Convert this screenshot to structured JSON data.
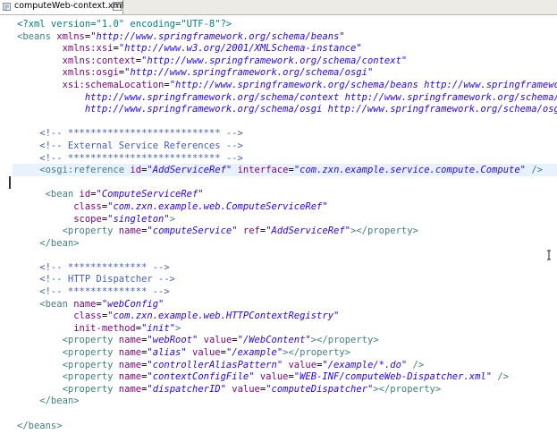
{
  "tab": {
    "title": "computeWeb-context.xml",
    "close_glyph": "×",
    "icon": "xml-file-icon"
  },
  "code_lines": [
    [
      {
        "k": "p",
        "s": "<?xml version=\"1.0\" encoding=\"UTF-8\"?>"
      }
    ],
    [
      {
        "k": "t",
        "s": "<beans "
      },
      {
        "k": "a",
        "s": "xmlns"
      },
      {
        "k": "x",
        "s": "="
      },
      {
        "k": "v",
        "s": "\"http://www.springframework.org/schema/beans\""
      }
    ],
    [
      {
        "k": "x",
        "s": "        "
      },
      {
        "k": "a",
        "s": "xmlns:xsi"
      },
      {
        "k": "x",
        "s": "="
      },
      {
        "k": "v",
        "s": "\"http://www.w3.org/2001/XMLSchema-instance\""
      }
    ],
    [
      {
        "k": "x",
        "s": "        "
      },
      {
        "k": "a",
        "s": "xmlns:context"
      },
      {
        "k": "x",
        "s": "="
      },
      {
        "k": "v",
        "s": "\"http://www.springframework.org/schema/context\""
      }
    ],
    [
      {
        "k": "x",
        "s": "        "
      },
      {
        "k": "a",
        "s": "xmlns:osgi"
      },
      {
        "k": "x",
        "s": "="
      },
      {
        "k": "v",
        "s": "\"http://www.springframework.org/schema/osgi\""
      }
    ],
    [
      {
        "k": "x",
        "s": "        "
      },
      {
        "k": "a",
        "s": "xsi:schemaLocation"
      },
      {
        "k": "x",
        "s": "="
      },
      {
        "k": "v",
        "s": "\"http://www.springframework.org/schema/beans http://www.springframework.org/schema/beans/spring-beans.xsd"
      }
    ],
    [
      {
        "k": "v",
        "s": "            http://www.springframework.org/schema/context http://www.springframework.org/schema/context/spring-context.xsd"
      }
    ],
    [
      {
        "k": "v",
        "s": "            http://www.springframework.org/schema/osgi http://www.springframework.org/schema/osgi/spring-osgi.xsd\">"
      }
    ],
    [],
    [
      {
        "k": "c",
        "s": "    <!-- *************************** -->"
      }
    ],
    [
      {
        "k": "c",
        "s": "    <!-- External Service References -->"
      }
    ],
    [
      {
        "k": "c",
        "s": "    <!-- *************************** -->"
      }
    ],
    [
      {
        "k": "t",
        "s": "    <osgi:reference "
      },
      {
        "k": "a",
        "s": "id"
      },
      {
        "k": "x",
        "s": "="
      },
      {
        "k": "v",
        "s": "\"AddServiceRef\""
      },
      {
        "k": "x",
        "s": " "
      },
      {
        "k": "a",
        "s": "interface"
      },
      {
        "k": "x",
        "s": "="
      },
      {
        "k": "v",
        "s": "\"com.zxn.example.service.compute.Compute\""
      },
      {
        "k": "t",
        "s": " />"
      }
    ],
    [],
    [
      {
        "k": "t",
        "s": "     <bean "
      },
      {
        "k": "a",
        "s": "id"
      },
      {
        "k": "x",
        "s": "="
      },
      {
        "k": "v",
        "s": "\"ComputeServiceRef\""
      }
    ],
    [
      {
        "k": "x",
        "s": "          "
      },
      {
        "k": "a",
        "s": "class"
      },
      {
        "k": "x",
        "s": "="
      },
      {
        "k": "v",
        "s": "\"com.zxn.example.web.ComputeServiceRef\""
      }
    ],
    [
      {
        "k": "x",
        "s": "          "
      },
      {
        "k": "a",
        "s": "scope"
      },
      {
        "k": "x",
        "s": "="
      },
      {
        "k": "v",
        "s": "\"singleton\""
      },
      {
        "k": "t",
        "s": ">"
      }
    ],
    [
      {
        "k": "t",
        "s": "        <property "
      },
      {
        "k": "a",
        "s": "name"
      },
      {
        "k": "x",
        "s": "="
      },
      {
        "k": "v",
        "s": "\"computeService\""
      },
      {
        "k": "x",
        "s": " "
      },
      {
        "k": "a",
        "s": "ref"
      },
      {
        "k": "x",
        "s": "="
      },
      {
        "k": "v",
        "s": "\"AddServiceRef\""
      },
      {
        "k": "t",
        "s": "></property>"
      }
    ],
    [
      {
        "k": "t",
        "s": "    </bean>"
      }
    ],
    [],
    [
      {
        "k": "c",
        "s": "    <!-- ************** -->"
      }
    ],
    [
      {
        "k": "c",
        "s": "    <!-- HTTP Dispatcher -->"
      }
    ],
    [
      {
        "k": "c",
        "s": "    <!-- ************** -->"
      }
    ],
    [
      {
        "k": "t",
        "s": "    <bean "
      },
      {
        "k": "a",
        "s": "name"
      },
      {
        "k": "x",
        "s": "="
      },
      {
        "k": "v",
        "s": "\"webConfig\""
      }
    ],
    [
      {
        "k": "x",
        "s": "          "
      },
      {
        "k": "a",
        "s": "class"
      },
      {
        "k": "x",
        "s": "="
      },
      {
        "k": "v",
        "s": "\"com.zxn.example.web.HTTPContextRegistry\""
      }
    ],
    [
      {
        "k": "x",
        "s": "          "
      },
      {
        "k": "a",
        "s": "init-method"
      },
      {
        "k": "x",
        "s": "="
      },
      {
        "k": "v",
        "s": "\"init\""
      },
      {
        "k": "t",
        "s": ">"
      }
    ],
    [
      {
        "k": "t",
        "s": "        <property "
      },
      {
        "k": "a",
        "s": "name"
      },
      {
        "k": "x",
        "s": "="
      },
      {
        "k": "v",
        "s": "\"webRoot\""
      },
      {
        "k": "x",
        "s": " "
      },
      {
        "k": "a",
        "s": "value"
      },
      {
        "k": "x",
        "s": "="
      },
      {
        "k": "v",
        "s": "\"/WebContent\""
      },
      {
        "k": "t",
        "s": "></property>"
      }
    ],
    [
      {
        "k": "t",
        "s": "        <property "
      },
      {
        "k": "a",
        "s": "name"
      },
      {
        "k": "x",
        "s": "="
      },
      {
        "k": "v",
        "s": "\"alias\""
      },
      {
        "k": "x",
        "s": " "
      },
      {
        "k": "a",
        "s": "value"
      },
      {
        "k": "x",
        "s": "="
      },
      {
        "k": "v",
        "s": "\"/example\""
      },
      {
        "k": "t",
        "s": "></property>"
      }
    ],
    [
      {
        "k": "t",
        "s": "        <property "
      },
      {
        "k": "a",
        "s": "name"
      },
      {
        "k": "x",
        "s": "="
      },
      {
        "k": "v",
        "s": "\"controllerAliasPattern\""
      },
      {
        "k": "x",
        "s": " "
      },
      {
        "k": "a",
        "s": "value"
      },
      {
        "k": "x",
        "s": "="
      },
      {
        "k": "v",
        "s": "\"/example/*.do\""
      },
      {
        "k": "t",
        "s": " />"
      }
    ],
    [
      {
        "k": "t",
        "s": "        <property "
      },
      {
        "k": "a",
        "s": "name"
      },
      {
        "k": "x",
        "s": "="
      },
      {
        "k": "v",
        "s": "\"contextConfigFile\""
      },
      {
        "k": "x",
        "s": " "
      },
      {
        "k": "a",
        "s": "value"
      },
      {
        "k": "x",
        "s": "="
      },
      {
        "k": "v",
        "s": "\"WEB-INF/computeWeb-Dispatcher.xml\""
      },
      {
        "k": "t",
        "s": " />"
      }
    ],
    [
      {
        "k": "t",
        "s": "        <property "
      },
      {
        "k": "a",
        "s": "name"
      },
      {
        "k": "x",
        "s": "="
      },
      {
        "k": "v",
        "s": "\"dispatcherID\""
      },
      {
        "k": "x",
        "s": " "
      },
      {
        "k": "a",
        "s": "value"
      },
      {
        "k": "x",
        "s": "="
      },
      {
        "k": "v",
        "s": "\"computeDispatcher\""
      },
      {
        "k": "t",
        "s": "></property>"
      }
    ],
    [
      {
        "k": "t",
        "s": "    </bean>"
      }
    ],
    [],
    [
      {
        "k": "t",
        "s": "</beans>"
      }
    ]
  ],
  "highlighted_line": 12,
  "colors": {
    "processing_instruction": "#008080",
    "tag": "#3f7f7f",
    "attribute": "#7f007f",
    "value": "#2a00ff",
    "comment": "#3f5fbf",
    "current_line": "#e8f2fe"
  }
}
